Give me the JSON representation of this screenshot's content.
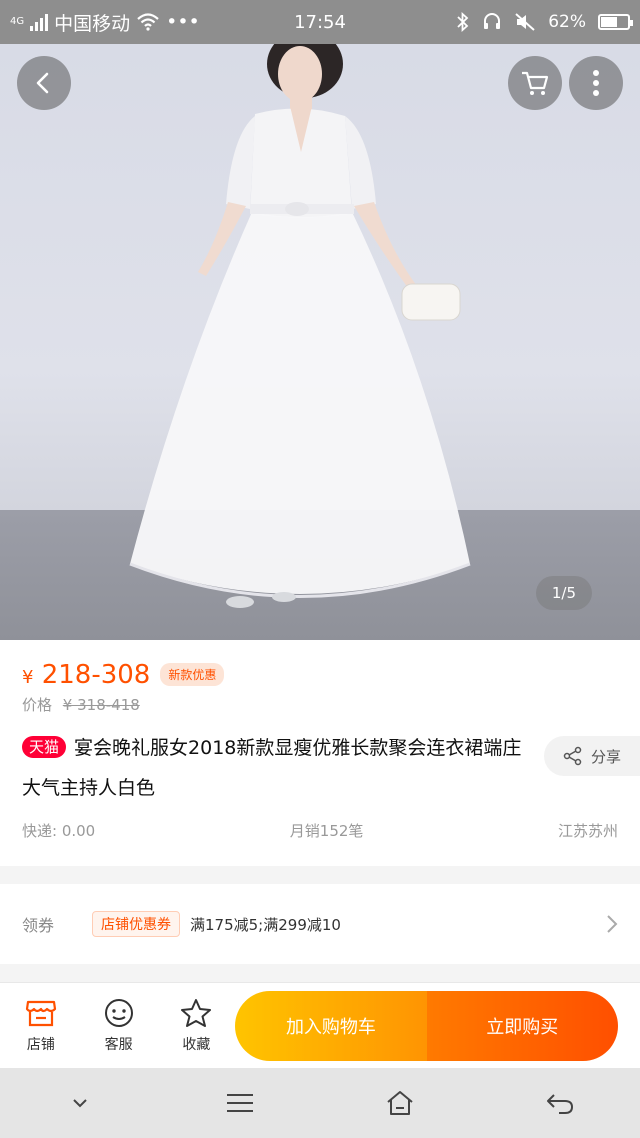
{
  "status_bar": {
    "network": "4G",
    "carrier": "中国移动",
    "dots": "•••",
    "time": "17:54",
    "battery": "62%",
    "battery_level": 0.62
  },
  "gallery": {
    "page_indicator": "1/5",
    "icons": [
      "back-icon",
      "cart-icon",
      "more-icon"
    ]
  },
  "product": {
    "currency": "¥",
    "price": "218-308",
    "promo_tag": "新款优惠",
    "orig_label": "价格",
    "orig_price": "¥ 318-418",
    "badge": "天猫",
    "title": "宴会晚礼服女2018新款显瘦优雅长款聚会连衣裙端庄大气主持人白色",
    "share_label": "分享",
    "shipping": "快递: 0.00",
    "monthly_sales": "月销152笔",
    "location": "江苏苏州"
  },
  "coupon": {
    "label": "领券",
    "tag": "店铺优惠券",
    "text": "满175减5;满299减10"
  },
  "bottom_bar": {
    "store": "店铺",
    "service": "客服",
    "favorite": "收藏",
    "add_to_cart": "加入购物车",
    "buy_now": "立即购买"
  },
  "colors": {
    "accent": "#ff5000",
    "tmall": "#ff0036",
    "cart_gradient": [
      "#ffc400",
      "#ff9402"
    ],
    "buy_gradient": [
      "#ff7a00",
      "#ff4f00"
    ]
  }
}
